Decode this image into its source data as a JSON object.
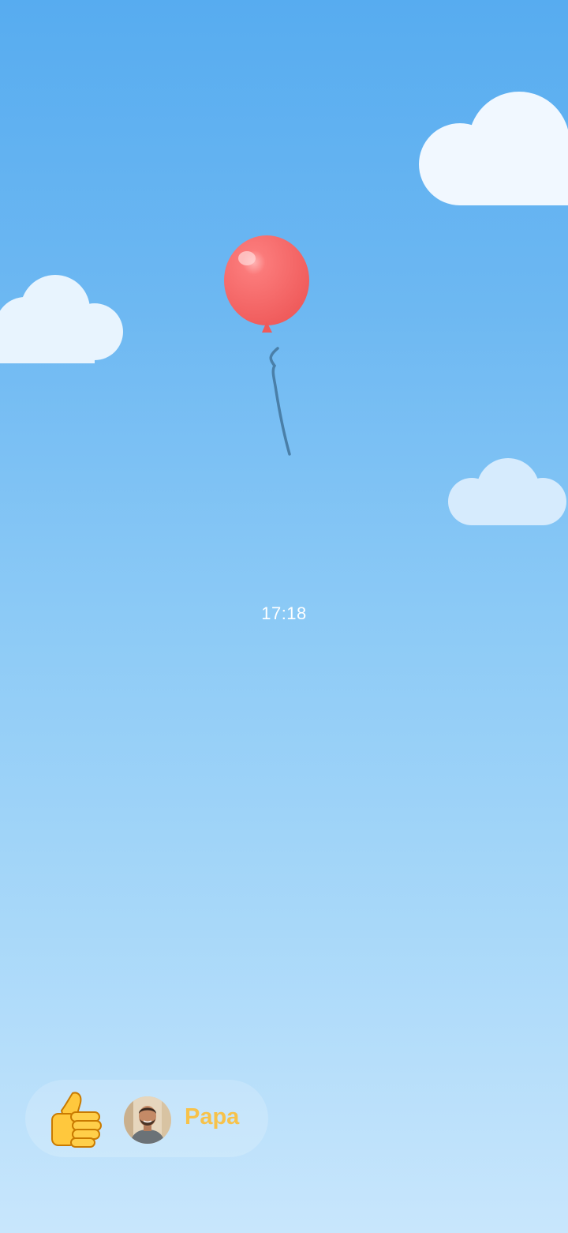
{
  "screen": {
    "time": "17:18"
  },
  "reaction": {
    "emoji_icon": "thumbs-up-icon",
    "sender_name": "Papa",
    "name_color": "#f7c24a"
  },
  "scene": {
    "balloon_color": "#f76566",
    "string_color": "#4a7fa8",
    "sky_top": "#57acf0",
    "sky_bottom": "#c8e6fc"
  }
}
